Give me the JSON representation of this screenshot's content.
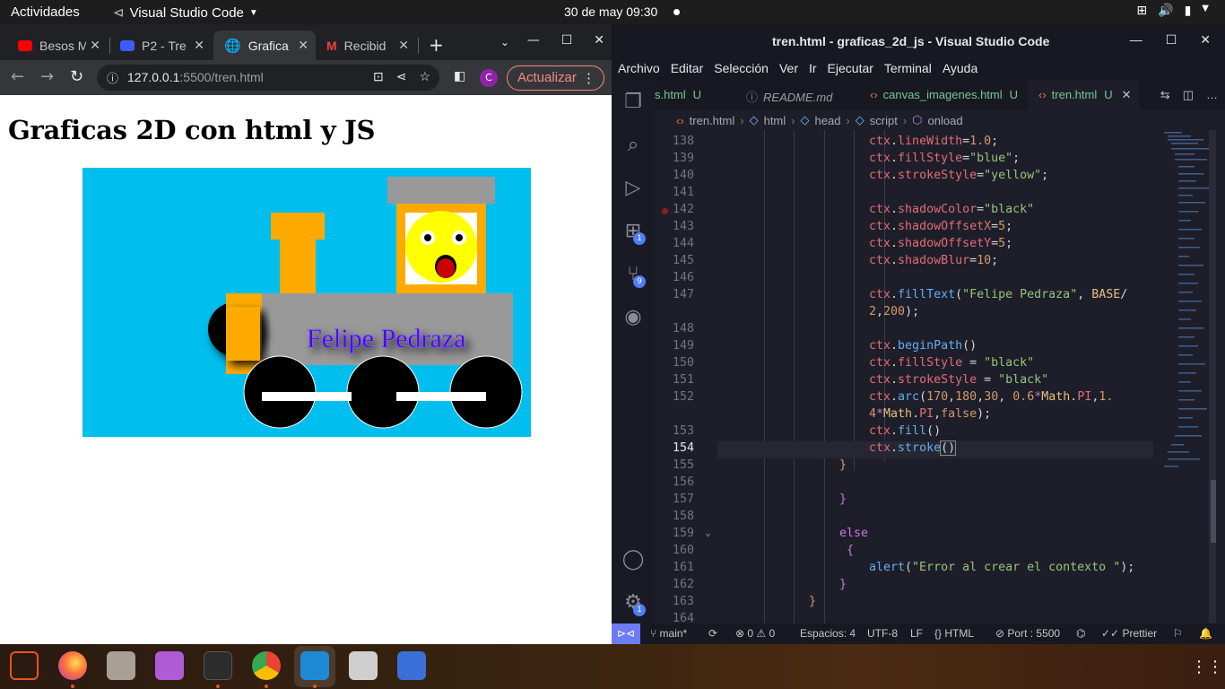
{
  "system": {
    "activities": "Actividades",
    "app_name": "Visual Studio Code",
    "clock": "30 de may  09:30"
  },
  "browser": {
    "tabs": [
      {
        "label": "Besos M",
        "icon": "youtube-icon",
        "color": "#ff0000"
      },
      {
        "label": "P2 - Tre",
        "icon": "classroom-icon",
        "color": "#3d5afe"
      },
      {
        "label": "Grafica",
        "icon": "globe-icon",
        "color": "#e8eaed"
      },
      {
        "label": "Recibid",
        "icon": "gmail-icon",
        "color": "#ea4335"
      }
    ],
    "url_host": "127.0.0.1",
    "url_rest": ":5500/tren.html",
    "profile_initial": "C",
    "update_label": "Actualizar",
    "page_heading": "Graficas 2D con html y JS",
    "canvas_text": "Felipe Pedraza"
  },
  "vscode": {
    "title": "tren.html - graficas_2d_js - Visual Studio Code",
    "menu": [
      "Archivo",
      "Editar",
      "Selección",
      "Ver",
      "Ir",
      "Ejecutar",
      "Terminal",
      "Ayuda"
    ],
    "tabs": [
      {
        "name": "s.html",
        "badge": "U"
      },
      {
        "name": "README.md",
        "badge": ""
      },
      {
        "name": "canvas_imagenes.html",
        "badge": "U"
      },
      {
        "name": "tren.html",
        "badge": "U"
      }
    ],
    "breadcrumb": [
      "tren.html",
      "html",
      "head",
      "script",
      "onload"
    ],
    "line_numbers": [
      "138",
      "139",
      "140",
      "141",
      "142",
      "143",
      "144",
      "145",
      "146",
      "147",
      "",
      "148",
      "149",
      "150",
      "151",
      "152",
      "",
      "153",
      "154",
      "155",
      "156",
      "157",
      "158",
      "159",
      "160",
      "161",
      "162",
      "163",
      "164"
    ],
    "activity_badges": {
      "extensions": "1",
      "source_control": "9",
      "settings": "1"
    },
    "status": {
      "branch": "main*",
      "problems": "⊗ 0 ⚠ 0",
      "spaces": "Espacios: 4",
      "encoding": "UTF-8",
      "eol": "LF",
      "language": "HTML",
      "port": "Port : 5500",
      "prettier": "Prettier"
    }
  },
  "dock": {
    "apps": [
      "screenshot-icon",
      "firefox-icon",
      "files-icon",
      "video-icon",
      "terminal-icon",
      "chrome-icon",
      "vscode-icon",
      "image-viewer-icon",
      "screenshot-select-icon"
    ]
  }
}
